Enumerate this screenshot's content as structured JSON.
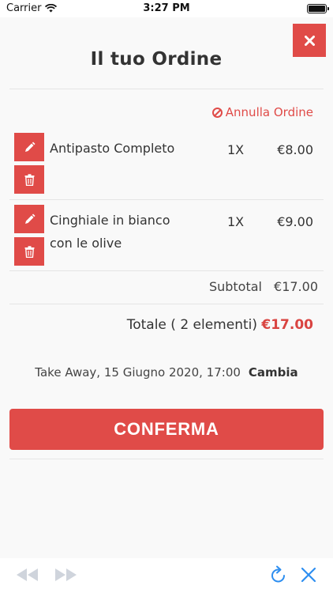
{
  "status_bar": {
    "carrier": "Carrier",
    "time": "3:27 PM"
  },
  "header": {
    "title": "Il tuo Ordine",
    "close_icon": "close-icon"
  },
  "cancel": {
    "label": "Annulla Ordine",
    "icon": "ban-icon"
  },
  "items": [
    {
      "name": "Antipasto Completo",
      "qty": "1X",
      "price": "€8.00"
    },
    {
      "name": "Cinghiale in bianco con le olive",
      "qty": "1X",
      "price": "€9.00"
    }
  ],
  "subtotal": {
    "label": "Subtotal",
    "value": "€17.00"
  },
  "total": {
    "label": "Totale ( 2 elementi)",
    "value": "€17.00"
  },
  "delivery": {
    "text": "Take Away, 15 Giugno 2020, 17:00",
    "change_label": "Cambia"
  },
  "confirm": {
    "label": "CONFERMA"
  },
  "colors": {
    "accent": "#e04b48",
    "total_price": "#d94441",
    "nav_icon": "#2d8ef0"
  },
  "browser_bar": {
    "icons": [
      "back-arrow-icon",
      "forward-arrow-icon",
      "refresh-icon",
      "close-icon"
    ]
  }
}
